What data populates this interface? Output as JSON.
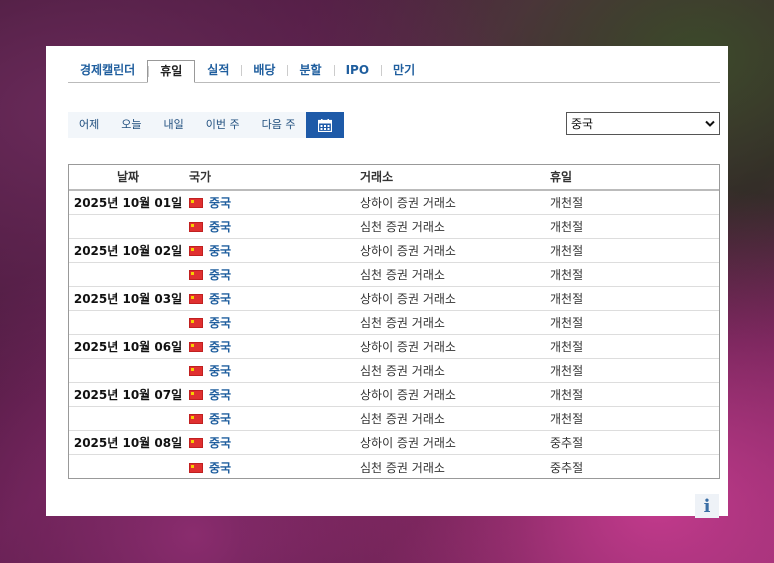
{
  "tabs": [
    {
      "label": "경제캘린더",
      "active": false
    },
    {
      "label": "휴일",
      "active": true
    },
    {
      "label": "실적",
      "active": false
    },
    {
      "label": "배당",
      "active": false
    },
    {
      "label": "분할",
      "active": false
    },
    {
      "label": "IPO",
      "active": false
    },
    {
      "label": "만기",
      "active": false
    }
  ],
  "date_buttons": {
    "yesterday": "어제",
    "today": "오늘",
    "tomorrow": "내일",
    "this_week": "이번 주",
    "next_week": "다음 주",
    "calendar_icon": "calendar-icon"
  },
  "country_select": {
    "value": "중국",
    "icon": "chevron-down-icon"
  },
  "table": {
    "headers": {
      "date": "날짜",
      "country": "국가",
      "exchange": "거래소",
      "holiday": "휴일"
    },
    "rows": [
      {
        "date": "2025년 10월 01일",
        "country": "중국",
        "exchange": "상하이 증권 거래소",
        "holiday": "개천절"
      },
      {
        "date": "",
        "country": "중국",
        "exchange": "심천 증권 거래소",
        "holiday": "개천절"
      },
      {
        "date": "2025년 10월 02일",
        "country": "중국",
        "exchange": "상하이 증권 거래소",
        "holiday": "개천절"
      },
      {
        "date": "",
        "country": "중국",
        "exchange": "심천 증권 거래소",
        "holiday": "개천절"
      },
      {
        "date": "2025년 10월 03일",
        "country": "중국",
        "exchange": "상하이 증권 거래소",
        "holiday": "개천절"
      },
      {
        "date": "",
        "country": "중국",
        "exchange": "심천 증권 거래소",
        "holiday": "개천절"
      },
      {
        "date": "2025년 10월 06일",
        "country": "중국",
        "exchange": "상하이 증권 거래소",
        "holiday": "개천절"
      },
      {
        "date": "",
        "country": "중국",
        "exchange": "심천 증권 거래소",
        "holiday": "개천절"
      },
      {
        "date": "2025년 10월 07일",
        "country": "중국",
        "exchange": "상하이 증권 거래소",
        "holiday": "개천절"
      },
      {
        "date": "",
        "country": "중국",
        "exchange": "심천 증권 거래소",
        "holiday": "개천절"
      },
      {
        "date": "2025년 10월 08일",
        "country": "중국",
        "exchange": "상하이 증권 거래소",
        "holiday": "중추절"
      },
      {
        "date": "",
        "country": "중국",
        "exchange": "심천 증권 거래소",
        "holiday": "중추절"
      }
    ]
  },
  "info_button": {
    "label": "i",
    "icon": "info-icon"
  },
  "colors": {
    "accent": "#1e5aa8",
    "link": "#1f5e9e",
    "flag_red": "#e03030"
  }
}
